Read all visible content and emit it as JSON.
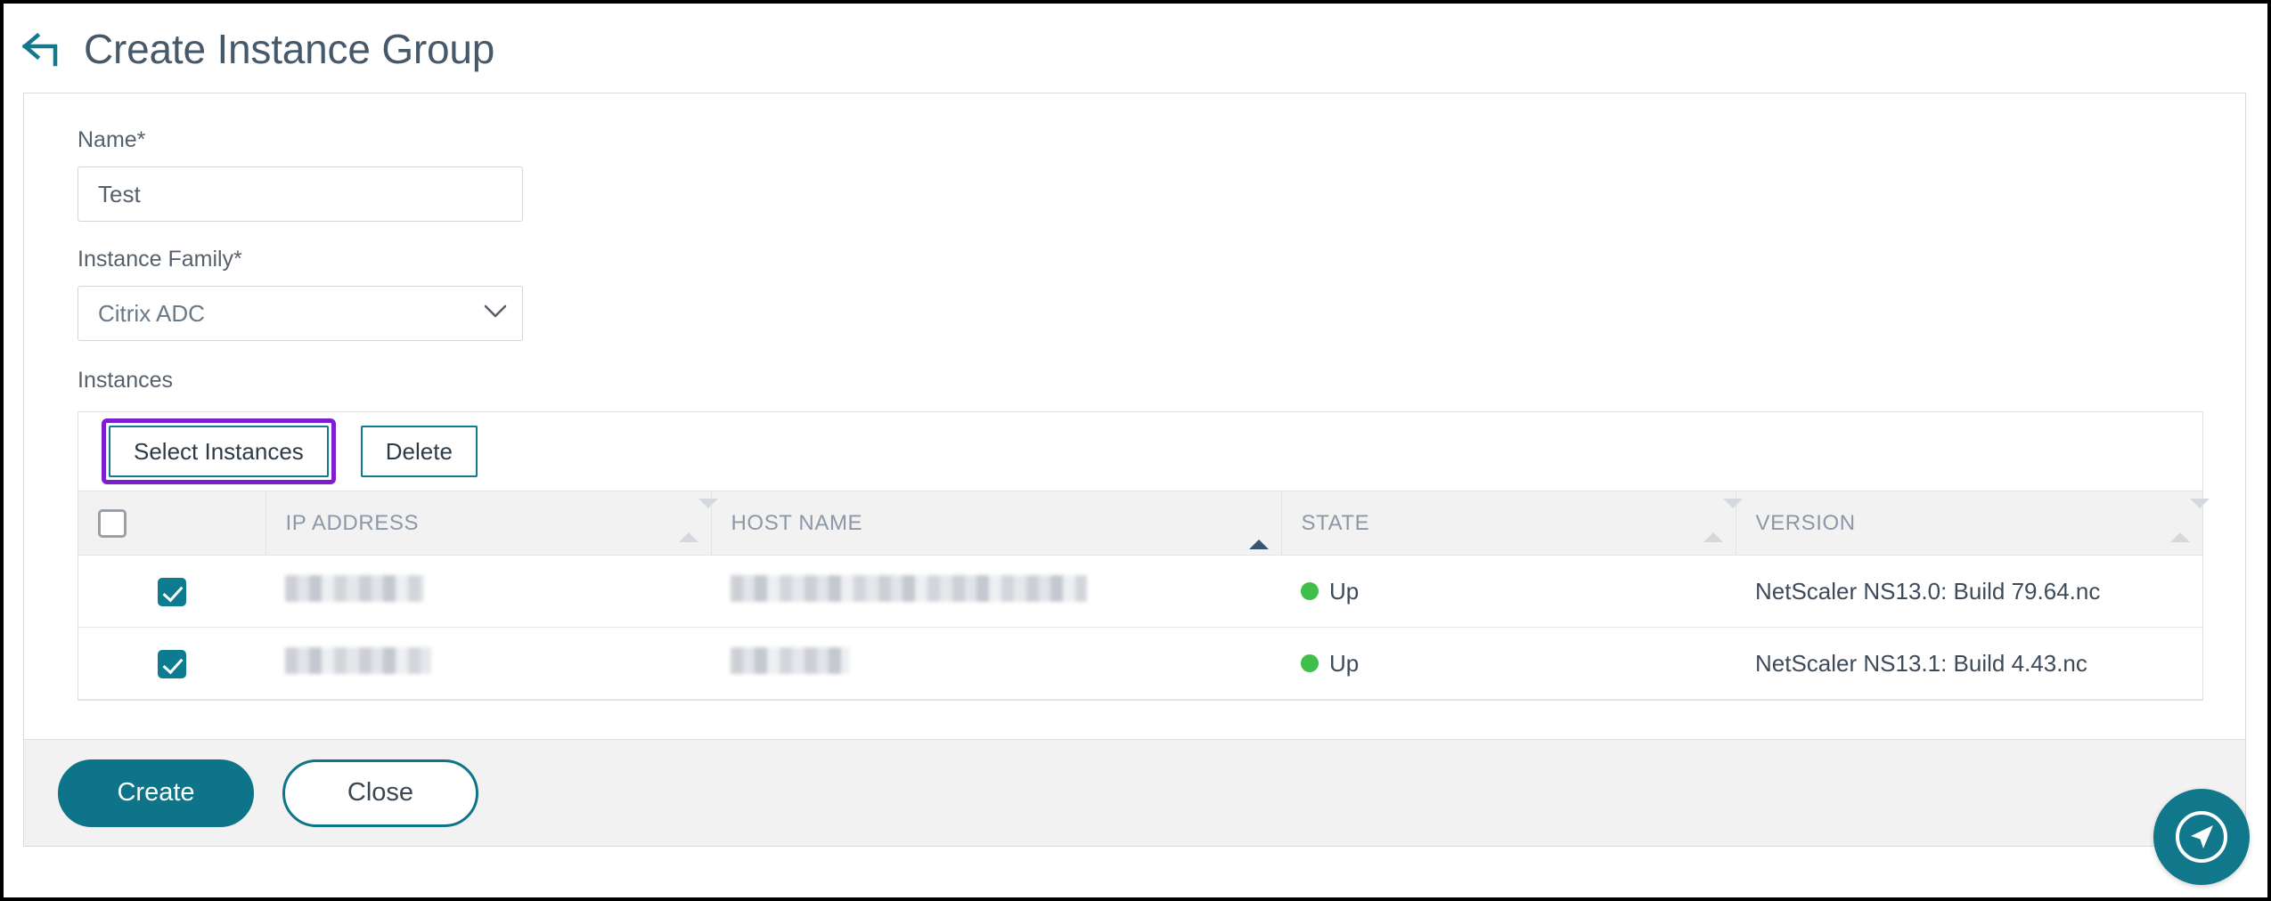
{
  "page": {
    "title": "Create Instance Group",
    "back_icon": "back-arrow-icon"
  },
  "form": {
    "name": {
      "label": "Name*",
      "value": "Test",
      "placeholder": "Name"
    },
    "instance_family": {
      "label": "Instance Family*",
      "value": "Citrix ADC",
      "chevron_icon": "chevron-down-icon"
    },
    "instances_label": "Instances"
  },
  "toolbar": {
    "select_instances_label": "Select Instances",
    "delete_label": "Delete",
    "highlight_color": "#7d1fd1"
  },
  "table": {
    "columns": [
      {
        "key": "check",
        "label": ""
      },
      {
        "key": "ip",
        "label": "IP ADDRESS",
        "sort": "none"
      },
      {
        "key": "host",
        "label": "HOST NAME",
        "sort": "asc"
      },
      {
        "key": "state",
        "label": "STATE",
        "sort": "none"
      },
      {
        "key": "version",
        "label": "VERSION",
        "sort": "none"
      }
    ],
    "header_checkbox": {
      "checked": false
    },
    "rows": [
      {
        "selected": true,
        "ip_address": "",
        "host_name": "",
        "state": "Up",
        "version": "NetScaler NS13.0: Build 79.64.nc"
      },
      {
        "selected": true,
        "ip_address": "",
        "host_name": "",
        "state": "Up",
        "version": "NetScaler NS13.1: Build 4.43.nc"
      }
    ]
  },
  "footer": {
    "create_label": "Create",
    "close_label": "Close"
  },
  "fab": {
    "icon": "navigation-arrow-icon"
  },
  "colors": {
    "accent_teal": "#0d7489",
    "status_up_green": "#3dbf4a",
    "title_gray": "#46596b",
    "highlight_purple": "#7d1fd1"
  }
}
